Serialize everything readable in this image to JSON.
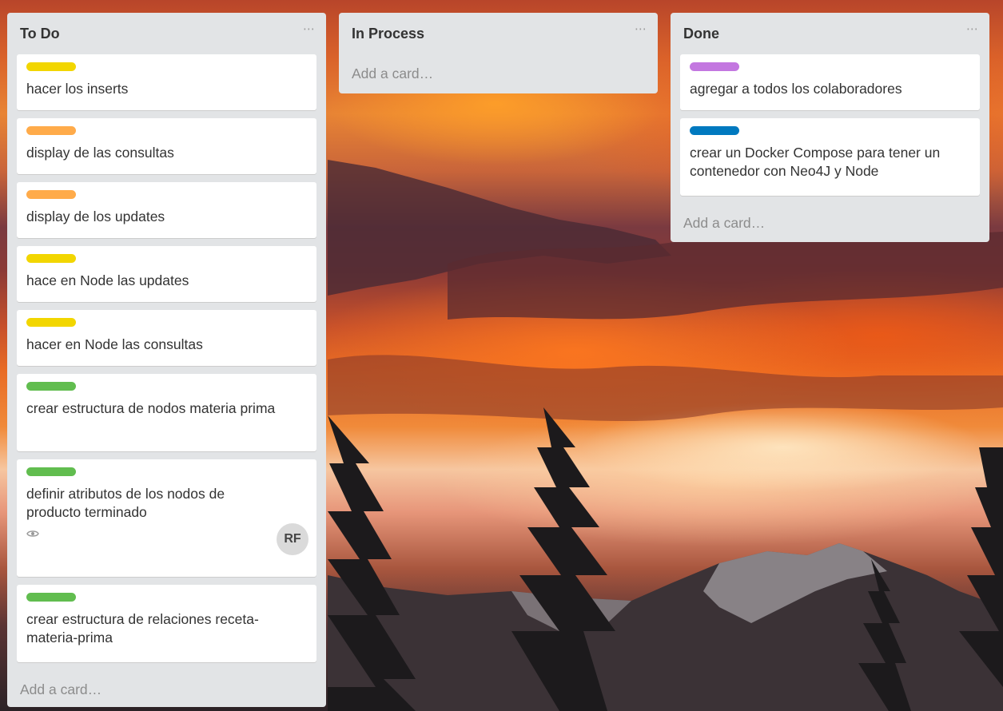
{
  "board": {
    "lists": [
      {
        "title": "To Do",
        "menu_icon": "ellipsis-icon",
        "add_card": "Add a card…",
        "cards": [
          {
            "label_color": "#f2d600",
            "title": "hacer los inserts"
          },
          {
            "label_color": "#ffab4a",
            "title": "display de las consultas"
          },
          {
            "label_color": "#ffab4a",
            "title": "display de los updates"
          },
          {
            "label_color": "#f2d600",
            "title": "hace en Node las updates"
          },
          {
            "label_color": "#f2d600",
            "title": "hacer en Node las consultas"
          },
          {
            "label_color": "#61bd4f",
            "title": "crear estructura de nodos materia prima"
          },
          {
            "label_color": "#61bd4f",
            "title": "definir atributos de los nodos de producto terminado",
            "badge_icon": "eye-icon",
            "member_initials": "RF"
          },
          {
            "label_color": "#61bd4f",
            "title": "crear estructura de relaciones receta-materia-prima"
          }
        ]
      },
      {
        "title": "In Process",
        "menu_icon": "ellipsis-icon",
        "add_card": "Add a card…",
        "cards": []
      },
      {
        "title": "Done",
        "menu_icon": "ellipsis-icon",
        "add_card": "Add a card…",
        "cards": [
          {
            "label_color": "#c377e0",
            "title": "agregar a todos los colaboradores"
          },
          {
            "label_color": "#0079bf",
            "title": "crear un Docker Compose para tener un contenedor con Neo4J y Node"
          }
        ]
      }
    ]
  }
}
